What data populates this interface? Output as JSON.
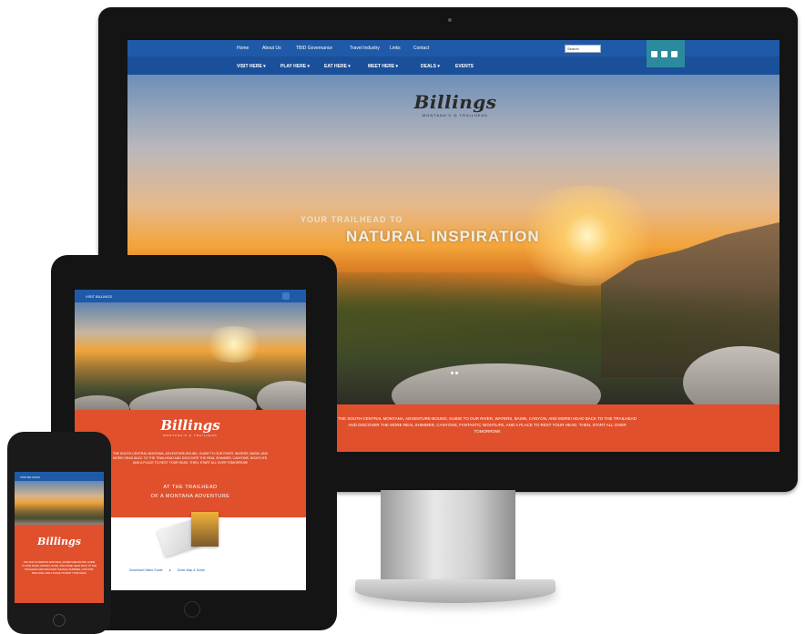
{
  "desktop": {
    "topnav": [
      "Home",
      "About Us",
      "TBID Governance",
      "Travel Industry",
      "Links",
      "Contact"
    ],
    "search_placeholder": "Search",
    "mainnav": [
      "VISIT HERE ▾",
      "PLAY HERE ▾",
      "EAT HERE ▾",
      "MEET HERE ▾",
      "DEALS ▾",
      "EVENTS"
    ],
    "logo_script": "Billings",
    "logo_sub_left": "MONTANA'S",
    "logo_sub_right": "TRAILHEAD",
    "tagline_small": "YOUR TRAILHEAD TO",
    "tagline_big": "NATURAL INSPIRATION",
    "band_text": "THE SOUTH-CENTRAL MONTANA, ADVENTURE-BOUND, GUIDE TO OUR RIVER, WATERS, BASIN, CANYON, AND MORE! HEAD BACK TO THE TRAILHEAD AND DISCOVER THE MORE REAL SHIMMER, CANYONS, FANTASTIC NIGHTLIFE, AND A PLACE TO REST YOUR HEAD. THEN, START ALL OVER TOMORROW!",
    "colors": {
      "nav": "#1f5aa8",
      "band": "#e0502c",
      "social": "#2c8a9e"
    }
  },
  "tablet": {
    "nav_label": "VISIT BILLINGS",
    "logo_script": "Billings",
    "logo_sub_left": "MONTANA'S",
    "logo_sub_right": "TRAILHEAD",
    "intro_text": "THE SOUTH-CENTRAL MONTANA, ADVENTURE-BOUND, GUIDE TO OUR RIVER, WATERS, BASIN, AND MORE! HEAD BACK TO THE TRAILHEAD AND DISCOVER THE REAL SHIMMER, CANYONS, NIGHTLIFE, AND A PLACE TO REST YOUR HEAD. THEN, START ALL OVER TOMORROW!",
    "trail_line1": "AT THE TRAILHEAD",
    "trail_line2": "OF A MONTANA ADVENTURE",
    "link_left": "Download Visitor Guide",
    "link_right": "Order Map & Guide"
  },
  "phone": {
    "nav_label": "VISIT BILLINGS",
    "logo_script": "Billings",
    "body_text": "THE SOUTH-CENTRAL MONTANA, ADVENTURE-BOUND, GUIDE TO OUR RIVER, WATERS, BASIN, AND MORE! HEAD BACK TO THE TRAILHEAD AND DISCOVER THE REAL SHIMMER, CANYONS, NIGHTLIFE, AND A PLACE TO REST YOUR HEAD."
  }
}
